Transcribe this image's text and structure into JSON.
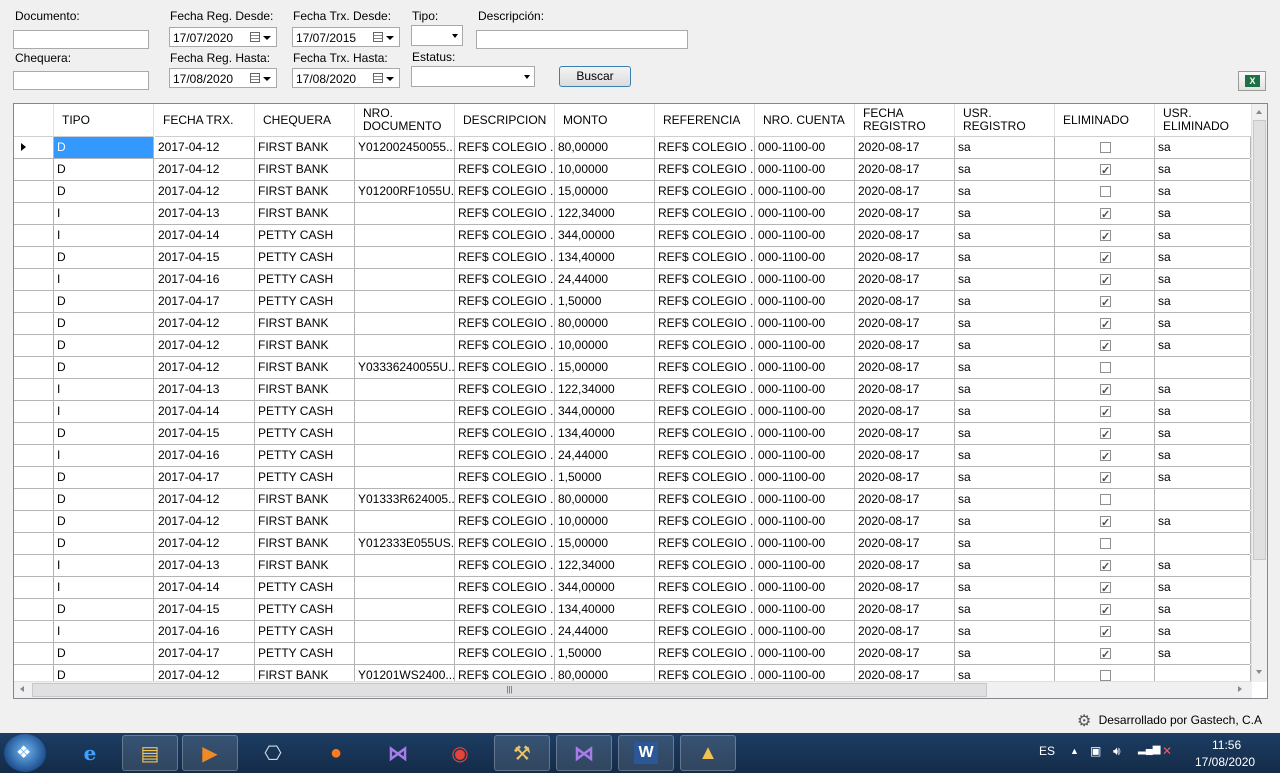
{
  "filters": {
    "documento_label": "Documento:",
    "chequera_label": "Chequera:",
    "fecha_reg_desde_label": "Fecha Reg. Desde:",
    "fecha_reg_desde_value": "17/07/2020",
    "fecha_reg_hasta_label": "Fecha Reg. Hasta:",
    "fecha_reg_hasta_value": "17/08/2020",
    "fecha_trx_desde_label": "Fecha Trx. Desde:",
    "fecha_trx_desde_value": "17/07/2015",
    "fecha_trx_hasta_label": "Fecha Trx. Hasta:",
    "fecha_trx_hasta_value": "17/08/2020",
    "tipo_label": "Tipo:",
    "estatus_label": "Estatus:",
    "descripcion_label": "Descripción:",
    "buscar_label": "Buscar"
  },
  "grid": {
    "columns": [
      {
        "key": "tipo",
        "label": "TIPO"
      },
      {
        "key": "fecha",
        "label": "FECHA TRX."
      },
      {
        "key": "chequera",
        "label": "CHEQUERA"
      },
      {
        "key": "doc",
        "label": "NRO. DOCUMENTO"
      },
      {
        "key": "desc",
        "label": "DESCRIPCION"
      },
      {
        "key": "monto",
        "label": "MONTO"
      },
      {
        "key": "ref",
        "label": "REFERENCIA"
      },
      {
        "key": "cuenta",
        "label": "NRO. CUENTA"
      },
      {
        "key": "freg",
        "label": "FECHA REGISTRO"
      },
      {
        "key": "usr",
        "label": "USR. REGISTRO"
      },
      {
        "key": "elim",
        "label": "ELIMINADO"
      },
      {
        "key": "usre",
        "label": "USR. ELIMINADO"
      }
    ],
    "rows": [
      {
        "tipo": "D",
        "fecha": "2017-04-12",
        "chequera": "FIRST BANK",
        "doc": "Y012002450055...",
        "desc": "REF$ COLEGIO ...",
        "monto": "80,00000",
        "ref": "REF$ COLEGIO ...",
        "cuenta": "000-1100-00",
        "freg": "2020-08-17",
        "usr": "sa",
        "elim": false,
        "usre": "sa"
      },
      {
        "tipo": "D",
        "fecha": "2017-04-12",
        "chequera": "FIRST BANK",
        "doc": "",
        "desc": "REF$ COLEGIO ...",
        "monto": "10,00000",
        "ref": "REF$ COLEGIO ...",
        "cuenta": "000-1100-00",
        "freg": "2020-08-17",
        "usr": "sa",
        "elim": true,
        "usre": "sa"
      },
      {
        "tipo": "D",
        "fecha": "2017-04-12",
        "chequera": "FIRST BANK",
        "doc": "Y01200RF1055U...",
        "desc": "REF$ COLEGIO ...",
        "monto": "15,00000",
        "ref": "REF$ COLEGIO ...",
        "cuenta": "000-1100-00",
        "freg": "2020-08-17",
        "usr": "sa",
        "elim": false,
        "usre": "sa"
      },
      {
        "tipo": "I",
        "fecha": "2017-04-13",
        "chequera": "FIRST BANK",
        "doc": "",
        "desc": "REF$ COLEGIO ...",
        "monto": "122,34000",
        "ref": "REF$ COLEGIO ...",
        "cuenta": "000-1100-00",
        "freg": "2020-08-17",
        "usr": "sa",
        "elim": true,
        "usre": "sa"
      },
      {
        "tipo": "I",
        "fecha": "2017-04-14",
        "chequera": "PETTY CASH",
        "doc": "",
        "desc": "REF$ COLEGIO ...",
        "monto": "344,00000",
        "ref": "REF$ COLEGIO ...",
        "cuenta": "000-1100-00",
        "freg": "2020-08-17",
        "usr": "sa",
        "elim": true,
        "usre": "sa"
      },
      {
        "tipo": "D",
        "fecha": "2017-04-15",
        "chequera": "PETTY CASH",
        "doc": "",
        "desc": "REF$ COLEGIO ...",
        "monto": "134,40000",
        "ref": "REF$ COLEGIO ...",
        "cuenta": "000-1100-00",
        "freg": "2020-08-17",
        "usr": "sa",
        "elim": true,
        "usre": "sa"
      },
      {
        "tipo": "I",
        "fecha": "2017-04-16",
        "chequera": "PETTY CASH",
        "doc": "",
        "desc": "REF$ COLEGIO ...",
        "monto": "24,44000",
        "ref": "REF$ COLEGIO ...",
        "cuenta": "000-1100-00",
        "freg": "2020-08-17",
        "usr": "sa",
        "elim": true,
        "usre": "sa"
      },
      {
        "tipo": "D",
        "fecha": "2017-04-17",
        "chequera": "PETTY CASH",
        "doc": "",
        "desc": "REF$ COLEGIO ...",
        "monto": "1,50000",
        "ref": "REF$ COLEGIO ...",
        "cuenta": "000-1100-00",
        "freg": "2020-08-17",
        "usr": "sa",
        "elim": true,
        "usre": "sa"
      },
      {
        "tipo": "D",
        "fecha": "2017-04-12",
        "chequera": "FIRST BANK",
        "doc": "",
        "desc": "REF$ COLEGIO ...",
        "monto": "80,00000",
        "ref": "REF$ COLEGIO ...",
        "cuenta": "000-1100-00",
        "freg": "2020-08-17",
        "usr": "sa",
        "elim": true,
        "usre": "sa"
      },
      {
        "tipo": "D",
        "fecha": "2017-04-12",
        "chequera": "FIRST BANK",
        "doc": "",
        "desc": "REF$ COLEGIO ...",
        "monto": "10,00000",
        "ref": "REF$ COLEGIO ...",
        "cuenta": "000-1100-00",
        "freg": "2020-08-17",
        "usr": "sa",
        "elim": true,
        "usre": "sa"
      },
      {
        "tipo": "D",
        "fecha": "2017-04-12",
        "chequera": "FIRST BANK",
        "doc": "Y03336240055U...",
        "desc": "REF$ COLEGIO ...",
        "monto": "15,00000",
        "ref": "REF$ COLEGIO ...",
        "cuenta": "000-1100-00",
        "freg": "2020-08-17",
        "usr": "sa",
        "elim": false,
        "usre": ""
      },
      {
        "tipo": "I",
        "fecha": "2017-04-13",
        "chequera": "FIRST BANK",
        "doc": "",
        "desc": "REF$ COLEGIO ...",
        "monto": "122,34000",
        "ref": "REF$ COLEGIO ...",
        "cuenta": "000-1100-00",
        "freg": "2020-08-17",
        "usr": "sa",
        "elim": true,
        "usre": "sa"
      },
      {
        "tipo": "I",
        "fecha": "2017-04-14",
        "chequera": "PETTY CASH",
        "doc": "",
        "desc": "REF$ COLEGIO ...",
        "monto": "344,00000",
        "ref": "REF$ COLEGIO ...",
        "cuenta": "000-1100-00",
        "freg": "2020-08-17",
        "usr": "sa",
        "elim": true,
        "usre": "sa"
      },
      {
        "tipo": "D",
        "fecha": "2017-04-15",
        "chequera": "PETTY CASH",
        "doc": "",
        "desc": "REF$ COLEGIO ...",
        "monto": "134,40000",
        "ref": "REF$ COLEGIO ...",
        "cuenta": "000-1100-00",
        "freg": "2020-08-17",
        "usr": "sa",
        "elim": true,
        "usre": "sa"
      },
      {
        "tipo": "I",
        "fecha": "2017-04-16",
        "chequera": "PETTY CASH",
        "doc": "",
        "desc": "REF$ COLEGIO ...",
        "monto": "24,44000",
        "ref": "REF$ COLEGIO ...",
        "cuenta": "000-1100-00",
        "freg": "2020-08-17",
        "usr": "sa",
        "elim": true,
        "usre": "sa"
      },
      {
        "tipo": "D",
        "fecha": "2017-04-17",
        "chequera": "PETTY CASH",
        "doc": "",
        "desc": "REF$ COLEGIO ...",
        "monto": "1,50000",
        "ref": "REF$ COLEGIO ...",
        "cuenta": "000-1100-00",
        "freg": "2020-08-17",
        "usr": "sa",
        "elim": true,
        "usre": "sa"
      },
      {
        "tipo": "D",
        "fecha": "2017-04-12",
        "chequera": "FIRST BANK",
        "doc": "Y01333R624005...",
        "desc": "REF$ COLEGIO ...",
        "monto": "80,00000",
        "ref": "REF$ COLEGIO ...",
        "cuenta": "000-1100-00",
        "freg": "2020-08-17",
        "usr": "sa",
        "elim": false,
        "usre": ""
      },
      {
        "tipo": "D",
        "fecha": "2017-04-12",
        "chequera": "FIRST BANK",
        "doc": "",
        "desc": "REF$ COLEGIO ...",
        "monto": "10,00000",
        "ref": "REF$ COLEGIO ...",
        "cuenta": "000-1100-00",
        "freg": "2020-08-17",
        "usr": "sa",
        "elim": true,
        "usre": "sa"
      },
      {
        "tipo": "D",
        "fecha": "2017-04-12",
        "chequera": "FIRST BANK",
        "doc": "Y012333E055US...",
        "desc": "REF$ COLEGIO ...",
        "monto": "15,00000",
        "ref": "REF$ COLEGIO ...",
        "cuenta": "000-1100-00",
        "freg": "2020-08-17",
        "usr": "sa",
        "elim": false,
        "usre": ""
      },
      {
        "tipo": "I",
        "fecha": "2017-04-13",
        "chequera": "FIRST BANK",
        "doc": "",
        "desc": "REF$ COLEGIO ...",
        "monto": "122,34000",
        "ref": "REF$ COLEGIO ...",
        "cuenta": "000-1100-00",
        "freg": "2020-08-17",
        "usr": "sa",
        "elim": true,
        "usre": "sa"
      },
      {
        "tipo": "I",
        "fecha": "2017-04-14",
        "chequera": "PETTY CASH",
        "doc": "",
        "desc": "REF$ COLEGIO ...",
        "monto": "344,00000",
        "ref": "REF$ COLEGIO ...",
        "cuenta": "000-1100-00",
        "freg": "2020-08-17",
        "usr": "sa",
        "elim": true,
        "usre": "sa"
      },
      {
        "tipo": "D",
        "fecha": "2017-04-15",
        "chequera": "PETTY CASH",
        "doc": "",
        "desc": "REF$ COLEGIO ...",
        "monto": "134,40000",
        "ref": "REF$ COLEGIO ...",
        "cuenta": "000-1100-00",
        "freg": "2020-08-17",
        "usr": "sa",
        "elim": true,
        "usre": "sa"
      },
      {
        "tipo": "I",
        "fecha": "2017-04-16",
        "chequera": "PETTY CASH",
        "doc": "",
        "desc": "REF$ COLEGIO ...",
        "monto": "24,44000",
        "ref": "REF$ COLEGIO ...",
        "cuenta": "000-1100-00",
        "freg": "2020-08-17",
        "usr": "sa",
        "elim": true,
        "usre": "sa"
      },
      {
        "tipo": "D",
        "fecha": "2017-04-17",
        "chequera": "PETTY CASH",
        "doc": "",
        "desc": "REF$ COLEGIO ...",
        "monto": "1,50000",
        "ref": "REF$ COLEGIO ...",
        "cuenta": "000-1100-00",
        "freg": "2020-08-17",
        "usr": "sa",
        "elim": true,
        "usre": "sa"
      },
      {
        "tipo": "D",
        "fecha": "2017-04-12",
        "chequera": "FIRST BANK",
        "doc": "Y01201WS2400...",
        "desc": "REF$ COLEGIO ...",
        "monto": "80,00000",
        "ref": "REF$ COLEGIO ...",
        "cuenta": "000-1100-00",
        "freg": "2020-08-17",
        "usr": "sa",
        "elim": false,
        "usre": ""
      }
    ]
  },
  "footer": {
    "credit": "Desarrollado por Gastech, C.A",
    "gear_icon": "gears-icon"
  },
  "taskbar": {
    "lang": "ES",
    "time": "11:56",
    "date": "17/08/2020",
    "icons": [
      "ie-icon",
      "file-explorer-icon",
      "media-player-icon",
      "remote-desktop-icon",
      "firefox-icon",
      "visual-studio-icon",
      "chrome-icon",
      "tools-icon",
      "visual-studio-icon",
      "word-icon",
      "report-icon"
    ]
  },
  "colors": {
    "selection": "#3399ff",
    "taskbar": "#1c3d63"
  }
}
